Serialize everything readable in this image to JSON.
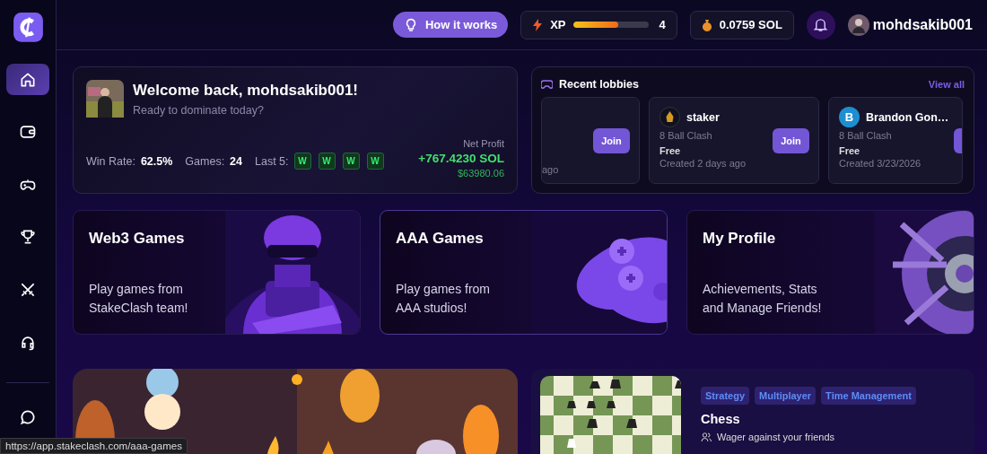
{
  "sidebar": {
    "items": [
      {
        "kind": "home",
        "selected": true
      },
      {
        "kind": "wallet",
        "selected": false
      },
      {
        "kind": "gamepad",
        "selected": false
      },
      {
        "kind": "trophy",
        "selected": false
      },
      {
        "kind": "swords",
        "selected": false
      },
      {
        "kind": "headset",
        "selected": false
      },
      {
        "kind": "chat",
        "selected": false
      }
    ]
  },
  "topbar": {
    "help_button": "How it works",
    "xp": {
      "label": "XP",
      "level": 0.6,
      "value": "4"
    },
    "balance": "0.0759 SOL",
    "username": "mohdsakib001"
  },
  "welcome": {
    "title": "Welcome back, mohdsakib001!",
    "subtitle": "Ready to dominate today?",
    "stats": [
      {
        "label": "Win Rate:",
        "value": "62.5%"
      },
      {
        "label": "Games:",
        "value": "24"
      }
    ],
    "last_label": "Last 5:",
    "last_results": [
      "W",
      "W",
      "W",
      "W"
    ],
    "profit_label": "Net Profit",
    "profit": "+767.4230 SOL",
    "profit_usd": "$63980.06"
  },
  "lobbies": {
    "title": "Recent lobbies",
    "link": "View all",
    "items": [
      {
        "created": "ago",
        "button": "Join"
      },
      {
        "host": "staker",
        "game": "8 Ball Clash",
        "stake": "Free",
        "created": "Created 2 days ago",
        "button": "Join"
      },
      {
        "host": "Brandon Gon…",
        "initial": "B",
        "game": "8 Ball Clash",
        "stake": "Free",
        "created": "Created 3/23/2026"
      }
    ]
  },
  "features": [
    {
      "kind": "soldier",
      "title": "Web3 Games",
      "text": "Play games from\nStakeClash team!"
    },
    {
      "kind": "gamepad",
      "title": "AAA Games",
      "text": "Play games from\nAAA studios!"
    },
    {
      "kind": "vault",
      "title": "My Profile",
      "text": "Achievements, Stats\nand Manage Friends!"
    }
  ],
  "game": {
    "tags": [
      "Strategy",
      "Multiplayer",
      "Time Management"
    ],
    "title": "Chess",
    "subtitle": "Wager against your friends"
  },
  "status_url": "https://app.stakeclash.com/aaa-games"
}
